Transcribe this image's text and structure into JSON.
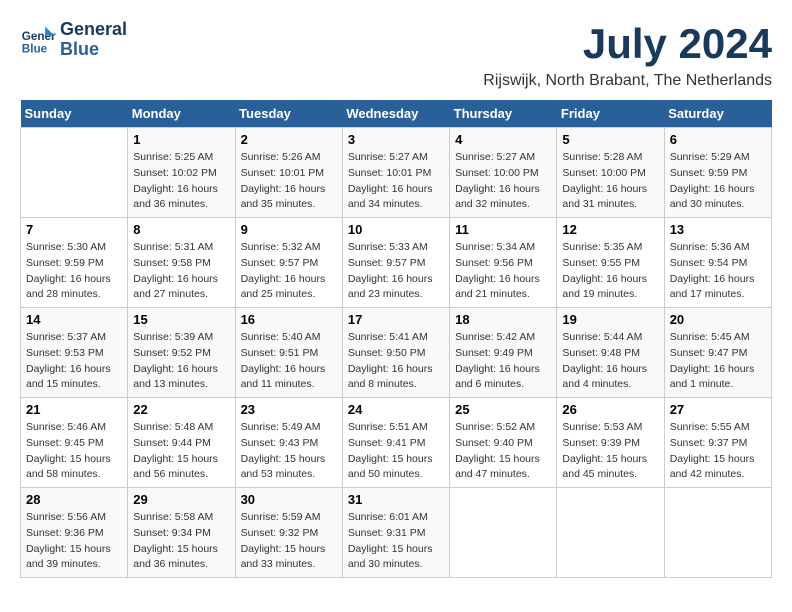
{
  "logo": {
    "line1": "General",
    "line2": "Blue"
  },
  "title": "July 2024",
  "location": "Rijswijk, North Brabant, The Netherlands",
  "days_header": [
    "Sunday",
    "Monday",
    "Tuesday",
    "Wednesday",
    "Thursday",
    "Friday",
    "Saturday"
  ],
  "weeks": [
    [
      {
        "num": "",
        "info": ""
      },
      {
        "num": "1",
        "info": "Sunrise: 5:25 AM\nSunset: 10:02 PM\nDaylight: 16 hours\nand 36 minutes."
      },
      {
        "num": "2",
        "info": "Sunrise: 5:26 AM\nSunset: 10:01 PM\nDaylight: 16 hours\nand 35 minutes."
      },
      {
        "num": "3",
        "info": "Sunrise: 5:27 AM\nSunset: 10:01 PM\nDaylight: 16 hours\nand 34 minutes."
      },
      {
        "num": "4",
        "info": "Sunrise: 5:27 AM\nSunset: 10:00 PM\nDaylight: 16 hours\nand 32 minutes."
      },
      {
        "num": "5",
        "info": "Sunrise: 5:28 AM\nSunset: 10:00 PM\nDaylight: 16 hours\nand 31 minutes."
      },
      {
        "num": "6",
        "info": "Sunrise: 5:29 AM\nSunset: 9:59 PM\nDaylight: 16 hours\nand 30 minutes."
      }
    ],
    [
      {
        "num": "7",
        "info": "Sunrise: 5:30 AM\nSunset: 9:59 PM\nDaylight: 16 hours\nand 28 minutes."
      },
      {
        "num": "8",
        "info": "Sunrise: 5:31 AM\nSunset: 9:58 PM\nDaylight: 16 hours\nand 27 minutes."
      },
      {
        "num": "9",
        "info": "Sunrise: 5:32 AM\nSunset: 9:57 PM\nDaylight: 16 hours\nand 25 minutes."
      },
      {
        "num": "10",
        "info": "Sunrise: 5:33 AM\nSunset: 9:57 PM\nDaylight: 16 hours\nand 23 minutes."
      },
      {
        "num": "11",
        "info": "Sunrise: 5:34 AM\nSunset: 9:56 PM\nDaylight: 16 hours\nand 21 minutes."
      },
      {
        "num": "12",
        "info": "Sunrise: 5:35 AM\nSunset: 9:55 PM\nDaylight: 16 hours\nand 19 minutes."
      },
      {
        "num": "13",
        "info": "Sunrise: 5:36 AM\nSunset: 9:54 PM\nDaylight: 16 hours\nand 17 minutes."
      }
    ],
    [
      {
        "num": "14",
        "info": "Sunrise: 5:37 AM\nSunset: 9:53 PM\nDaylight: 16 hours\nand 15 minutes."
      },
      {
        "num": "15",
        "info": "Sunrise: 5:39 AM\nSunset: 9:52 PM\nDaylight: 16 hours\nand 13 minutes."
      },
      {
        "num": "16",
        "info": "Sunrise: 5:40 AM\nSunset: 9:51 PM\nDaylight: 16 hours\nand 11 minutes."
      },
      {
        "num": "17",
        "info": "Sunrise: 5:41 AM\nSunset: 9:50 PM\nDaylight: 16 hours\nand 8 minutes."
      },
      {
        "num": "18",
        "info": "Sunrise: 5:42 AM\nSunset: 9:49 PM\nDaylight: 16 hours\nand 6 minutes."
      },
      {
        "num": "19",
        "info": "Sunrise: 5:44 AM\nSunset: 9:48 PM\nDaylight: 16 hours\nand 4 minutes."
      },
      {
        "num": "20",
        "info": "Sunrise: 5:45 AM\nSunset: 9:47 PM\nDaylight: 16 hours\nand 1 minute."
      }
    ],
    [
      {
        "num": "21",
        "info": "Sunrise: 5:46 AM\nSunset: 9:45 PM\nDaylight: 15 hours\nand 58 minutes."
      },
      {
        "num": "22",
        "info": "Sunrise: 5:48 AM\nSunset: 9:44 PM\nDaylight: 15 hours\nand 56 minutes."
      },
      {
        "num": "23",
        "info": "Sunrise: 5:49 AM\nSunset: 9:43 PM\nDaylight: 15 hours\nand 53 minutes."
      },
      {
        "num": "24",
        "info": "Sunrise: 5:51 AM\nSunset: 9:41 PM\nDaylight: 15 hours\nand 50 minutes."
      },
      {
        "num": "25",
        "info": "Sunrise: 5:52 AM\nSunset: 9:40 PM\nDaylight: 15 hours\nand 47 minutes."
      },
      {
        "num": "26",
        "info": "Sunrise: 5:53 AM\nSunset: 9:39 PM\nDaylight: 15 hours\nand 45 minutes."
      },
      {
        "num": "27",
        "info": "Sunrise: 5:55 AM\nSunset: 9:37 PM\nDaylight: 15 hours\nand 42 minutes."
      }
    ],
    [
      {
        "num": "28",
        "info": "Sunrise: 5:56 AM\nSunset: 9:36 PM\nDaylight: 15 hours\nand 39 minutes."
      },
      {
        "num": "29",
        "info": "Sunrise: 5:58 AM\nSunset: 9:34 PM\nDaylight: 15 hours\nand 36 minutes."
      },
      {
        "num": "30",
        "info": "Sunrise: 5:59 AM\nSunset: 9:32 PM\nDaylight: 15 hours\nand 33 minutes."
      },
      {
        "num": "31",
        "info": "Sunrise: 6:01 AM\nSunset: 9:31 PM\nDaylight: 15 hours\nand 30 minutes."
      },
      {
        "num": "",
        "info": ""
      },
      {
        "num": "",
        "info": ""
      },
      {
        "num": "",
        "info": ""
      }
    ]
  ]
}
